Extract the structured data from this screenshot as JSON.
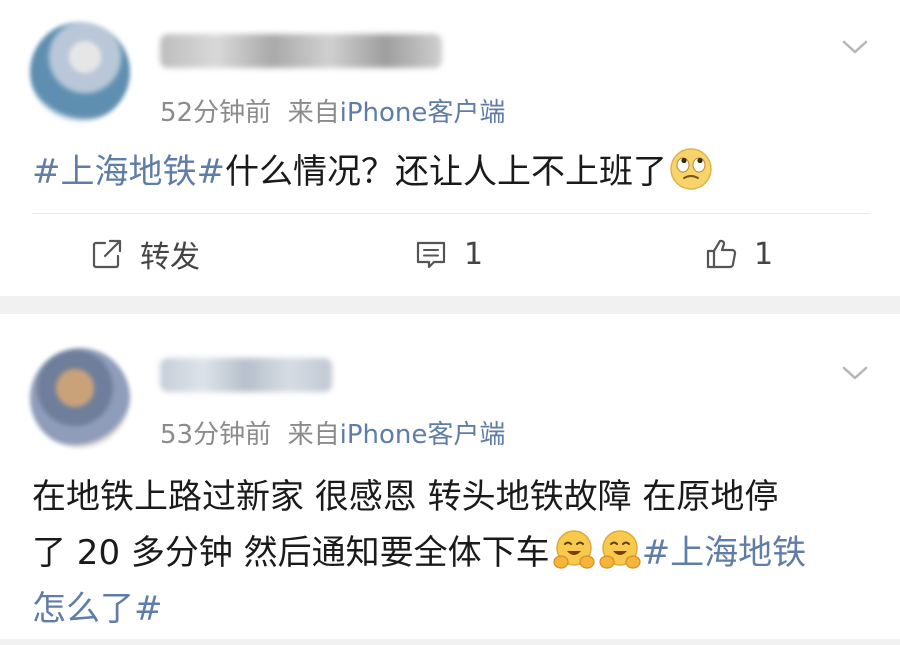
{
  "posts": [
    {
      "time": "52分钟前",
      "source_prefix": "来自",
      "source": "iPhone客户端",
      "content": {
        "tag": "#上海地铁#",
        "text": "什么情况？还让人上不上班了"
      },
      "actions": {
        "repost": "转发",
        "comments": "1",
        "likes": "1"
      }
    },
    {
      "time": "53分钟前",
      "source_prefix": "来自",
      "source": "iPhone客户端",
      "content": {
        "line1": "在地铁上路过新家 很感恩 转头地铁故障  在原地停",
        "line2_text": "了 20 多分钟 然后通知要全体下车",
        "line2_tag": "#上海地铁",
        "line3_tag": "怎么了#"
      }
    }
  ],
  "colors": {
    "link": "#5f7da6",
    "meta": "#8b8b8b",
    "separator": "#f1f1f1"
  }
}
